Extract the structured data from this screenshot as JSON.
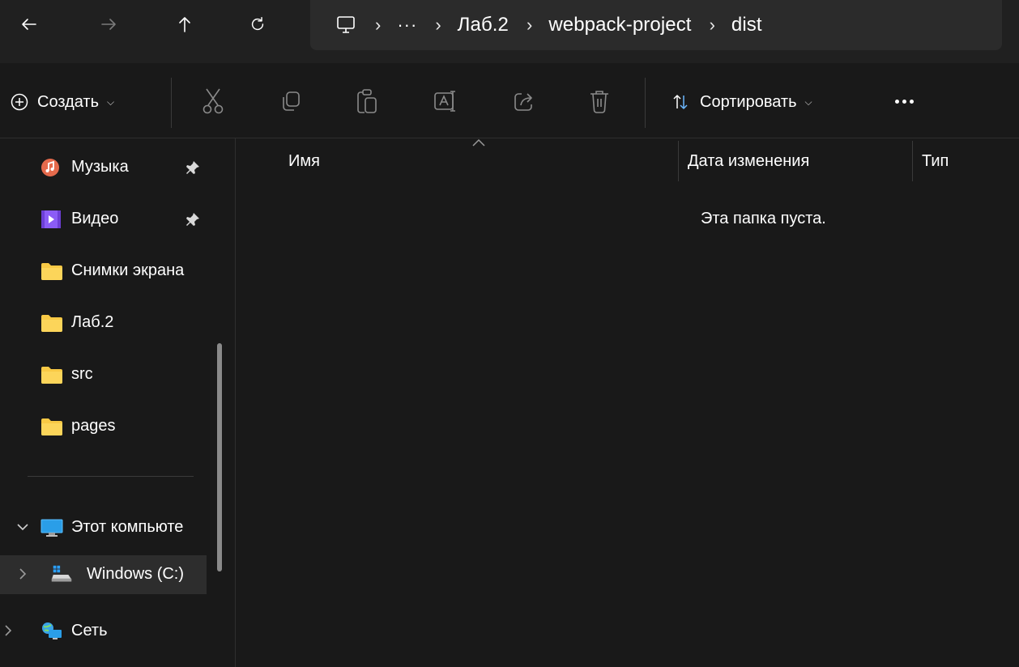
{
  "navigation": {
    "back_icon": "arrow-left-icon",
    "forward_icon": "arrow-right-icon",
    "up_icon": "arrow-up-icon",
    "refresh_icon": "refresh-icon"
  },
  "address_bar": {
    "root_icon": "monitor-icon",
    "overflow": "···",
    "crumbs": [
      "Лаб.2",
      "webpack-project",
      "dist"
    ]
  },
  "command_bar": {
    "create_label": "Создать",
    "sort_label": "Сортировать",
    "tools": [
      "cut-icon",
      "copy-icon",
      "paste-icon",
      "rename-icon",
      "share-icon",
      "delete-icon"
    ]
  },
  "nav_pane": {
    "items": [
      {
        "label": "Музыка",
        "icon": "music-icon",
        "pinned": true
      },
      {
        "label": "Видео",
        "icon": "video-icon",
        "pinned": true
      },
      {
        "label": "Снимки экрана",
        "icon": "folder-icon"
      },
      {
        "label": "Лаб.2",
        "icon": "folder-icon"
      },
      {
        "label": "src",
        "icon": "folder-icon"
      },
      {
        "label": "pages",
        "icon": "folder-icon"
      }
    ],
    "tree": [
      {
        "label": "Этот компьюте",
        "icon": "computer-icon",
        "expanded": true
      },
      {
        "label": "Windows (C:)",
        "icon": "drive-icon",
        "selected": true
      },
      {
        "label": "Сеть",
        "icon": "network-icon"
      }
    ]
  },
  "list_view": {
    "columns": [
      "Имя",
      "Дата изменения",
      "Тип"
    ],
    "empty_message": "Эта папка пуста."
  },
  "colors": {
    "background": "#191919",
    "titlebar": "#202020",
    "address": "#2b2b2b",
    "folder": "#f8c945",
    "selected": "#2d2d2d"
  }
}
